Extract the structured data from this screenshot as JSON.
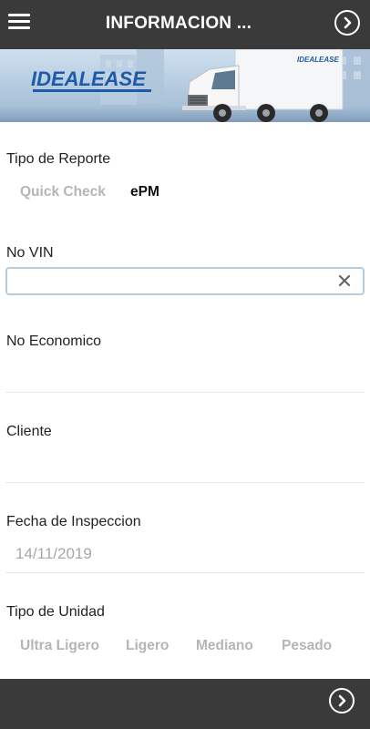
{
  "header": {
    "title": "INFORMACION ...",
    "menu_icon": "hamburger-menu-icon",
    "next_icon": "chevron-right-circle-icon"
  },
  "banner": {
    "brand": "IDEALEASE",
    "truck_brand": "IDEALEASE"
  },
  "form": {
    "tipo_reporte": {
      "label": "Tipo de Reporte",
      "options": [
        "Quick Check",
        "ePM"
      ],
      "selected": "ePM"
    },
    "no_vin": {
      "label": "No VIN",
      "value": "",
      "clear_icon": "clear-x-icon"
    },
    "no_economico": {
      "label": "No Economico",
      "value": ""
    },
    "cliente": {
      "label": "Cliente",
      "value": ""
    },
    "fecha_inspeccion": {
      "label": "Fecha de Inspeccion",
      "value": "14/11/2019"
    },
    "tipo_unidad": {
      "label": "Tipo de Unidad",
      "options": [
        "Ultra Ligero",
        "Ligero",
        "Mediano",
        "Pesado"
      ]
    }
  },
  "colors": {
    "bar": "#3a3a3a",
    "inactive_option": "#b5b5b5",
    "input_focus_border": "#b4cde0",
    "brand_blue": "#1f5aa8"
  }
}
